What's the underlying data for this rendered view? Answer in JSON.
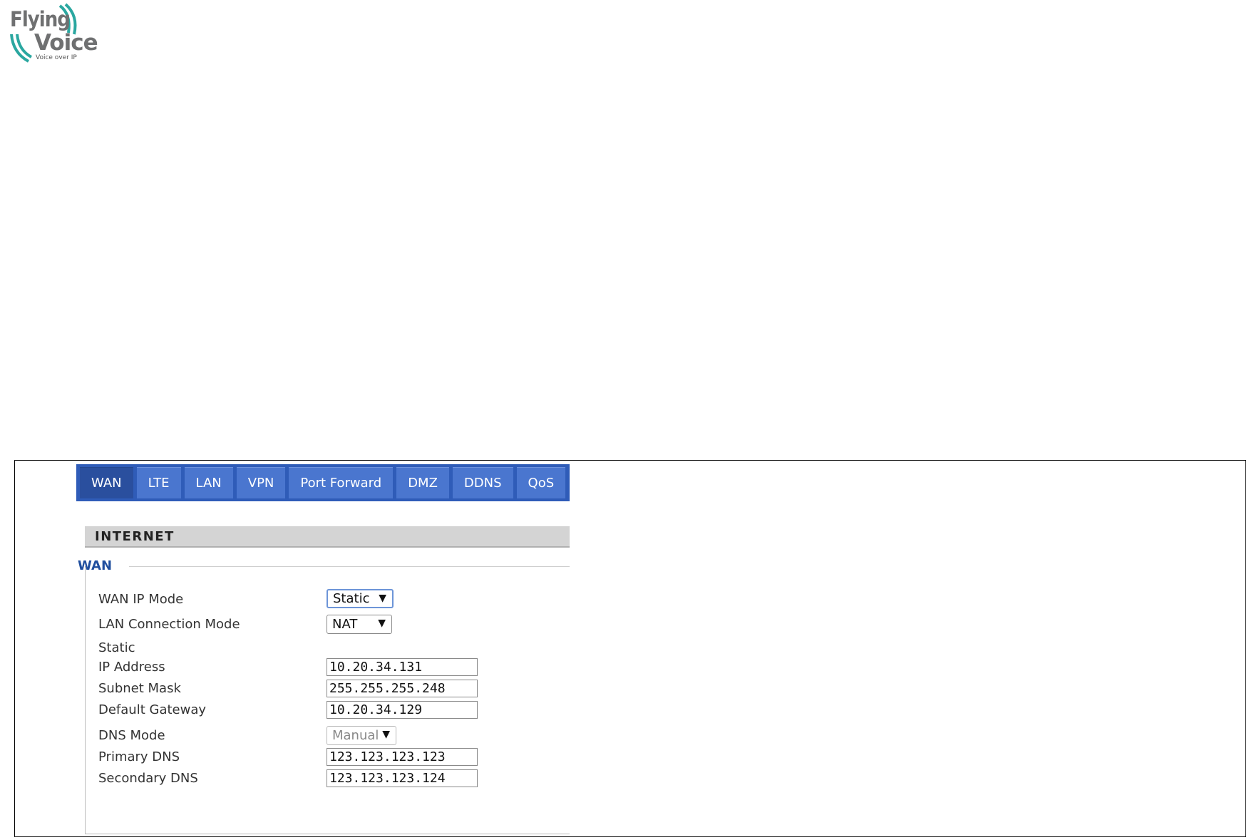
{
  "logo": {
    "line1": "Flying",
    "line2": "Voice",
    "tagline": "Voice over IP"
  },
  "tabs": [
    {
      "label": "WAN",
      "active": true
    },
    {
      "label": "LTE"
    },
    {
      "label": "LAN"
    },
    {
      "label": "VPN"
    },
    {
      "label": "Port Forward"
    },
    {
      "label": "DMZ"
    },
    {
      "label": "DDNS"
    },
    {
      "label": "QoS"
    }
  ],
  "section": {
    "title": "INTERNET"
  },
  "wan": {
    "legend": "WAN",
    "wan_ip_mode": {
      "label": "WAN IP Mode",
      "value": "Static"
    },
    "lan_connection_mode": {
      "label": "LAN Connection Mode",
      "value": "NAT"
    },
    "static_heading": "Static",
    "ip_address": {
      "label": "IP Address",
      "value": "10.20.34.131"
    },
    "subnet_mask": {
      "label": "Subnet Mask",
      "value": "255.255.255.248"
    },
    "default_gateway": {
      "label": "Default Gateway",
      "value": "10.20.34.129"
    },
    "dns_mode": {
      "label": "DNS Mode",
      "value": "Manual"
    },
    "primary_dns": {
      "label": "Primary DNS",
      "value": "123.123.123.123"
    },
    "secondary_dns": {
      "label": "Secondary DNS",
      "value": "123.123.123.124"
    }
  },
  "colors": {
    "tab_bar": "#2f5cb8",
    "tab": "#4a76cf",
    "tab_active": "#2a4f9e",
    "legend": "#1f4e9e",
    "logo_arc": "#2aa7a0"
  }
}
